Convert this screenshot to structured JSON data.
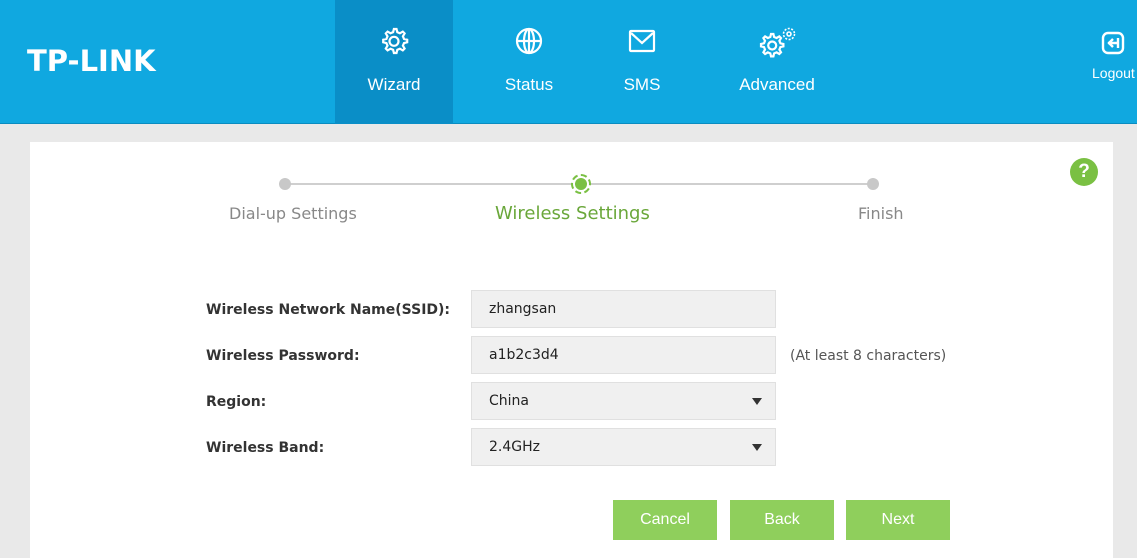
{
  "header": {
    "logo": "TP-LINK",
    "nav": [
      {
        "label": "Wizard",
        "icon": "gear-icon",
        "active": true
      },
      {
        "label": "Status",
        "icon": "globe-icon",
        "active": false
      },
      {
        "label": "SMS",
        "icon": "envelope-icon",
        "active": false
      },
      {
        "label": "Advanced",
        "icon": "gears-icon",
        "active": false
      }
    ],
    "logout": {
      "label": "Logout",
      "icon": "logout-icon"
    }
  },
  "help": {
    "label": "?"
  },
  "stepper": {
    "steps": [
      {
        "label": "Dial-up Settings",
        "active": false
      },
      {
        "label": "Wireless Settings",
        "active": true
      },
      {
        "label": "Finish",
        "active": false
      }
    ]
  },
  "form": {
    "ssid": {
      "label": "Wireless Network Name(SSID):",
      "value": "zhangsan"
    },
    "password": {
      "label": "Wireless Password:",
      "value": "a1b2c3d4",
      "hint": "(At least 8 characters)"
    },
    "region": {
      "label": "Region:",
      "value": "China"
    },
    "band": {
      "label": "Wireless Band:",
      "value": "2.4GHz"
    }
  },
  "buttons": {
    "cancel": "Cancel",
    "back": "Back",
    "next": "Next"
  },
  "colors": {
    "header": "#10a8e0",
    "active_nav": "#0a8ec7",
    "accent": "#7ac043",
    "button": "#8fcf5c"
  }
}
